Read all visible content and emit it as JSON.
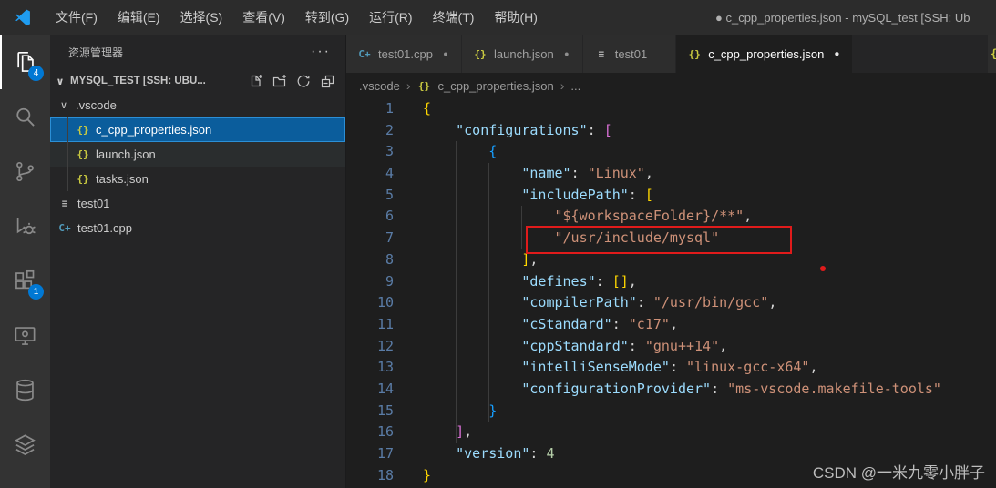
{
  "title_bar": {
    "menus": [
      "文件(F)",
      "编辑(E)",
      "选择(S)",
      "查看(V)",
      "转到(G)",
      "运行(R)",
      "终端(T)",
      "帮助(H)"
    ],
    "window_title": "● c_cpp_properties.json - mySQL_test [SSH: Ub"
  },
  "activity_bar": {
    "explorer_badge": "4",
    "extensions_badge": "1"
  },
  "sidebar": {
    "title": "资源管理器",
    "more_label": "···",
    "section_label": "MYSQL_TEST [SSH: UBU...",
    "tree": [
      {
        "label": ".vscode",
        "level": 0,
        "expanded": true
      },
      {
        "label": "c_cpp_properties.json",
        "icon": "json",
        "level": 1,
        "selected": true
      },
      {
        "label": "launch.json",
        "icon": "json",
        "level": 1,
        "hovered": true
      },
      {
        "label": "tasks.json",
        "icon": "json",
        "level": 1
      },
      {
        "label": "test01",
        "icon": "makefile",
        "level": 0
      },
      {
        "label": "test01.cpp",
        "icon": "cpp",
        "level": 0
      }
    ]
  },
  "editor": {
    "tabs": [
      {
        "label": "test01.cpp",
        "icon": "cpp",
        "modified": true,
        "active": false
      },
      {
        "label": "launch.json",
        "icon": "json",
        "modified": true,
        "active": false
      },
      {
        "label": "test01",
        "icon": "makefile",
        "modified": false,
        "active": false
      },
      {
        "label": "c_cpp_properties.json",
        "icon": "json",
        "modified": true,
        "active": true
      }
    ],
    "partial_tab_glyph": "{",
    "breadcrumb": [
      {
        "label": ".vscode"
      },
      {
        "label": "c_cpp_properties.json",
        "icon": "json"
      },
      {
        "label": "..."
      }
    ],
    "code_lines": [
      {
        "n": 1,
        "tokens": [
          [
            "b1",
            "{"
          ]
        ]
      },
      {
        "n": 2,
        "tokens": [
          [
            "p",
            "    "
          ],
          [
            "key",
            "\"configurations\""
          ],
          [
            "p",
            ": "
          ],
          [
            "b2",
            "["
          ]
        ]
      },
      {
        "n": 3,
        "tokens": [
          [
            "p",
            "        "
          ],
          [
            "b3",
            "{"
          ]
        ]
      },
      {
        "n": 4,
        "tokens": [
          [
            "p",
            "            "
          ],
          [
            "key",
            "\"name\""
          ],
          [
            "p",
            ": "
          ],
          [
            "str",
            "\"Linux\""
          ],
          [
            "p",
            ","
          ]
        ]
      },
      {
        "n": 5,
        "tokens": [
          [
            "p",
            "            "
          ],
          [
            "key",
            "\"includePath\""
          ],
          [
            "p",
            ": "
          ],
          [
            "b1",
            "["
          ]
        ]
      },
      {
        "n": 6,
        "tokens": [
          [
            "p",
            "                "
          ],
          [
            "str",
            "\"${workspaceFolder}/**\""
          ],
          [
            "p",
            ","
          ]
        ]
      },
      {
        "n": 7,
        "tokens": [
          [
            "p",
            "                "
          ],
          [
            "str",
            "\"/usr/include/mysql\""
          ]
        ]
      },
      {
        "n": 8,
        "tokens": [
          [
            "p",
            "            "
          ],
          [
            "b1",
            "]"
          ],
          [
            "p",
            ","
          ]
        ]
      },
      {
        "n": 9,
        "tokens": [
          [
            "p",
            "            "
          ],
          [
            "key",
            "\"defines\""
          ],
          [
            "p",
            ": "
          ],
          [
            "b1",
            "[]"
          ],
          [
            "p",
            ","
          ]
        ]
      },
      {
        "n": 10,
        "tokens": [
          [
            "p",
            "            "
          ],
          [
            "key",
            "\"compilerPath\""
          ],
          [
            "p",
            ": "
          ],
          [
            "str",
            "\"/usr/bin/gcc\""
          ],
          [
            "p",
            ","
          ]
        ]
      },
      {
        "n": 11,
        "tokens": [
          [
            "p",
            "            "
          ],
          [
            "key",
            "\"cStandard\""
          ],
          [
            "p",
            ": "
          ],
          [
            "str",
            "\"c17\""
          ],
          [
            "p",
            ","
          ]
        ]
      },
      {
        "n": 12,
        "tokens": [
          [
            "p",
            "            "
          ],
          [
            "key",
            "\"cppStandard\""
          ],
          [
            "p",
            ": "
          ],
          [
            "str",
            "\"gnu++14\""
          ],
          [
            "p",
            ","
          ]
        ]
      },
      {
        "n": 13,
        "tokens": [
          [
            "p",
            "            "
          ],
          [
            "key",
            "\"intelliSenseMode\""
          ],
          [
            "p",
            ": "
          ],
          [
            "str",
            "\"linux-gcc-x64\""
          ],
          [
            "p",
            ","
          ]
        ]
      },
      {
        "n": 14,
        "tokens": [
          [
            "p",
            "            "
          ],
          [
            "key",
            "\"configurationProvider\""
          ],
          [
            "p",
            ": "
          ],
          [
            "str",
            "\"ms-vscode.makefile-tools\""
          ]
        ]
      },
      {
        "n": 15,
        "tokens": [
          [
            "p",
            "        "
          ],
          [
            "b3",
            "}"
          ]
        ]
      },
      {
        "n": 16,
        "tokens": [
          [
            "p",
            "    "
          ],
          [
            "b2",
            "]"
          ],
          [
            "p",
            ","
          ]
        ]
      },
      {
        "n": 17,
        "tokens": [
          [
            "p",
            "    "
          ],
          [
            "key",
            "\"version\""
          ],
          [
            "p",
            ": "
          ],
          [
            "num",
            "4"
          ]
        ]
      },
      {
        "n": 18,
        "tokens": [
          [
            "b1",
            "}"
          ]
        ]
      }
    ]
  },
  "colors": {
    "accent": "#0078d4",
    "selection_background": "#0b5d9c",
    "annotation_red": "#e01b1b",
    "json_icon_yellow": "#cbcb41",
    "cpp_icon_blue": "#519aba"
  },
  "watermark": "CSDN @一米九零小胖子"
}
